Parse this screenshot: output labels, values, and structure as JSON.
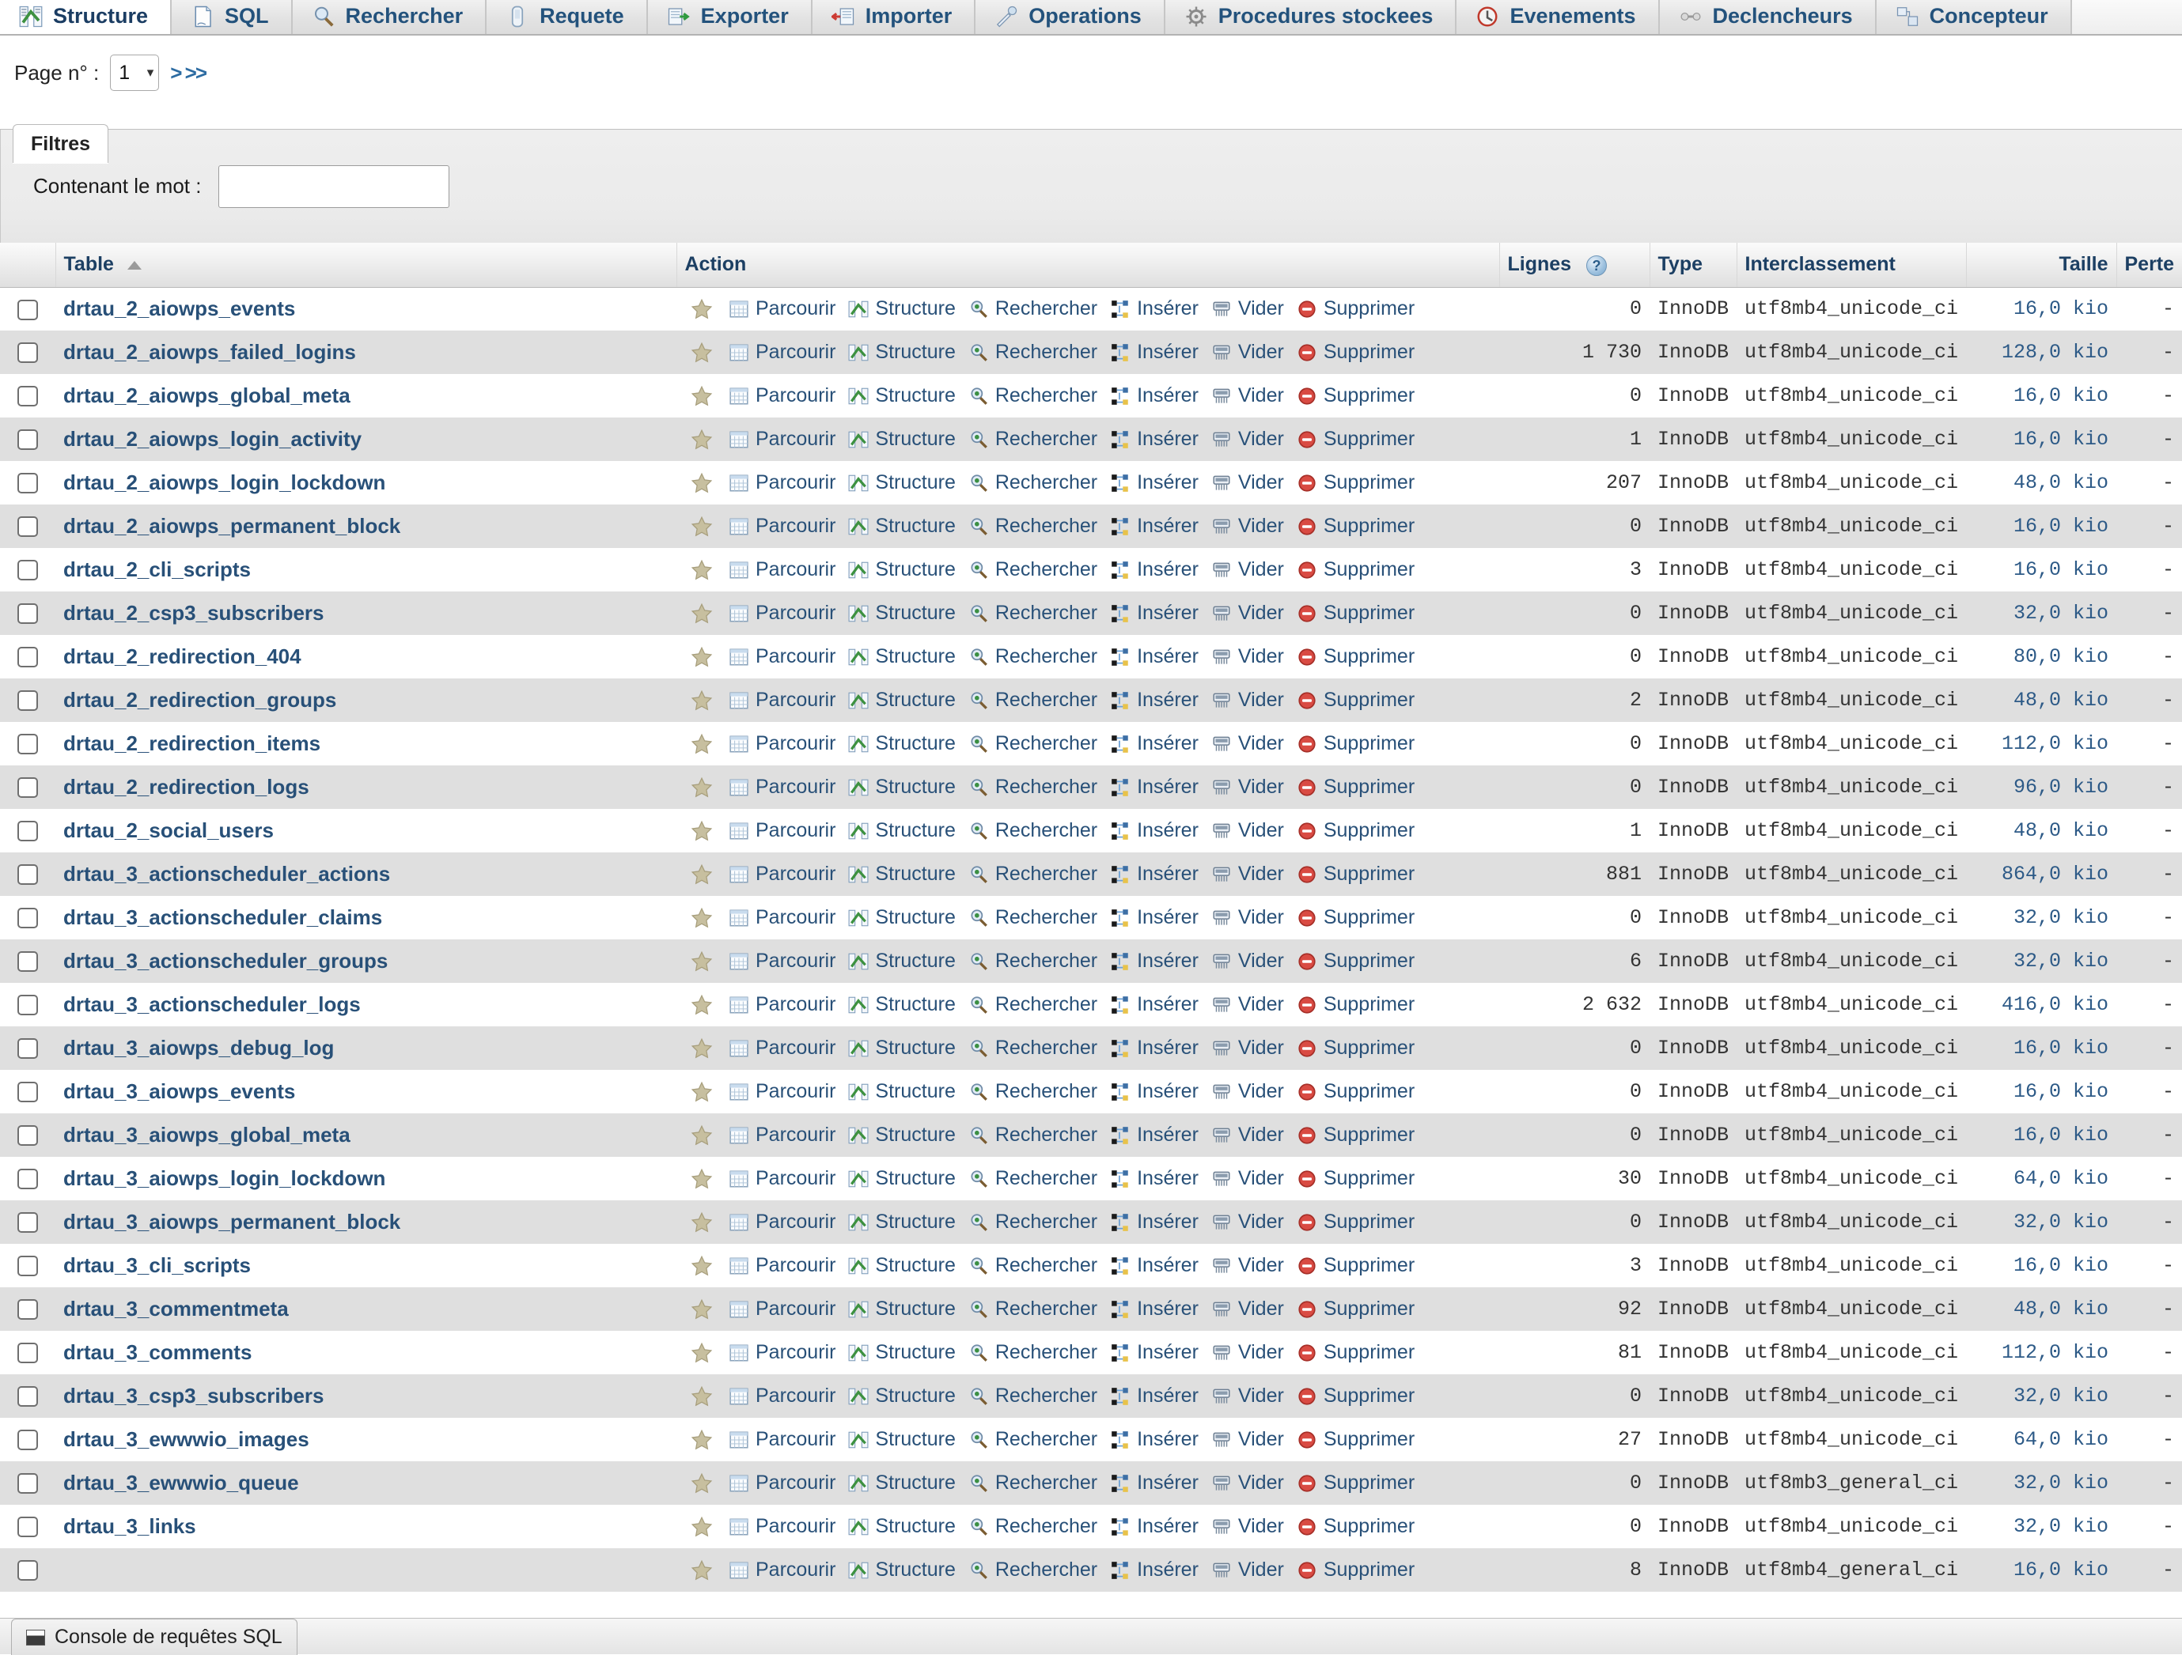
{
  "tabs": [
    {
      "label": "Structure",
      "icon": "structure-icon",
      "active": true
    },
    {
      "label": "SQL",
      "icon": "sql-icon",
      "active": false
    },
    {
      "label": "Rechercher",
      "icon": "search-icon",
      "active": false
    },
    {
      "label": "Requete",
      "icon": "query-icon",
      "active": false
    },
    {
      "label": "Exporter",
      "icon": "export-icon",
      "active": false
    },
    {
      "label": "Importer",
      "icon": "import-icon",
      "active": false
    },
    {
      "label": "Operations",
      "icon": "operations-icon",
      "active": false
    },
    {
      "label": "Procedures stockees",
      "icon": "routines-icon",
      "active": false
    },
    {
      "label": "Evenements",
      "icon": "events-icon",
      "active": false
    },
    {
      "label": "Declencheurs",
      "icon": "triggers-icon",
      "active": false
    },
    {
      "label": "Concepteur",
      "icon": "designer-icon",
      "active": false
    }
  ],
  "pagination": {
    "label": "Page n° :",
    "current_page": "1",
    "next_arrows": "> >>"
  },
  "filters": {
    "legend": "Filtres",
    "word_label": "Contenant le mot :",
    "word_value": "",
    "word_placeholder": ""
  },
  "table_headers": {
    "table": "Table",
    "action": "Action",
    "rows": "Lignes",
    "type": "Type",
    "collation": "Interclassement",
    "size": "Taille",
    "overhead": "Perte"
  },
  "actions": {
    "favorite": "",
    "browse": "Parcourir",
    "structure": "Structure",
    "search": "Rechercher",
    "insert": "Insérer",
    "empty": "Vider",
    "drop": "Supprimer"
  },
  "console": {
    "label": "Console de requêtes SQL"
  },
  "colors": {
    "link": "#285078",
    "header_text": "#1c3f63",
    "row_even": "#dfdfdf",
    "row_odd": "#ffffff",
    "size_text": "#2d5a87"
  },
  "rows": [
    {
      "name": "drtau_2_aiowps_events",
      "rows": "0",
      "type": "InnoDB",
      "collation": "utf8mb4_unicode_ci",
      "size": "16,0 kio",
      "overhead": "-"
    },
    {
      "name": "drtau_2_aiowps_failed_logins",
      "rows": "1 730",
      "type": "InnoDB",
      "collation": "utf8mb4_unicode_ci",
      "size": "128,0 kio",
      "overhead": "-"
    },
    {
      "name": "drtau_2_aiowps_global_meta",
      "rows": "0",
      "type": "InnoDB",
      "collation": "utf8mb4_unicode_ci",
      "size": "16,0 kio",
      "overhead": "-"
    },
    {
      "name": "drtau_2_aiowps_login_activity",
      "rows": "1",
      "type": "InnoDB",
      "collation": "utf8mb4_unicode_ci",
      "size": "16,0 kio",
      "overhead": "-"
    },
    {
      "name": "drtau_2_aiowps_login_lockdown",
      "rows": "207",
      "type": "InnoDB",
      "collation": "utf8mb4_unicode_ci",
      "size": "48,0 kio",
      "overhead": "-"
    },
    {
      "name": "drtau_2_aiowps_permanent_block",
      "rows": "0",
      "type": "InnoDB",
      "collation": "utf8mb4_unicode_ci",
      "size": "16,0 kio",
      "overhead": "-"
    },
    {
      "name": "drtau_2_cli_scripts",
      "rows": "3",
      "type": "InnoDB",
      "collation": "utf8mb4_unicode_ci",
      "size": "16,0 kio",
      "overhead": "-"
    },
    {
      "name": "drtau_2_csp3_subscribers",
      "rows": "0",
      "type": "InnoDB",
      "collation": "utf8mb4_unicode_ci",
      "size": "32,0 kio",
      "overhead": "-"
    },
    {
      "name": "drtau_2_redirection_404",
      "rows": "0",
      "type": "InnoDB",
      "collation": "utf8mb4_unicode_ci",
      "size": "80,0 kio",
      "overhead": "-"
    },
    {
      "name": "drtau_2_redirection_groups",
      "rows": "2",
      "type": "InnoDB",
      "collation": "utf8mb4_unicode_ci",
      "size": "48,0 kio",
      "overhead": "-"
    },
    {
      "name": "drtau_2_redirection_items",
      "rows": "0",
      "type": "InnoDB",
      "collation": "utf8mb4_unicode_ci",
      "size": "112,0 kio",
      "overhead": "-"
    },
    {
      "name": "drtau_2_redirection_logs",
      "rows": "0",
      "type": "InnoDB",
      "collation": "utf8mb4_unicode_ci",
      "size": "96,0 kio",
      "overhead": "-"
    },
    {
      "name": "drtau_2_social_users",
      "rows": "1",
      "type": "InnoDB",
      "collation": "utf8mb4_unicode_ci",
      "size": "48,0 kio",
      "overhead": "-"
    },
    {
      "name": "drtau_3_actionscheduler_actions",
      "rows": "881",
      "type": "InnoDB",
      "collation": "utf8mb4_unicode_ci",
      "size": "864,0 kio",
      "overhead": "-"
    },
    {
      "name": "drtau_3_actionscheduler_claims",
      "rows": "0",
      "type": "InnoDB",
      "collation": "utf8mb4_unicode_ci",
      "size": "32,0 kio",
      "overhead": "-"
    },
    {
      "name": "drtau_3_actionscheduler_groups",
      "rows": "6",
      "type": "InnoDB",
      "collation": "utf8mb4_unicode_ci",
      "size": "32,0 kio",
      "overhead": "-"
    },
    {
      "name": "drtau_3_actionscheduler_logs",
      "rows": "2 632",
      "type": "InnoDB",
      "collation": "utf8mb4_unicode_ci",
      "size": "416,0 kio",
      "overhead": "-"
    },
    {
      "name": "drtau_3_aiowps_debug_log",
      "rows": "0",
      "type": "InnoDB",
      "collation": "utf8mb4_unicode_ci",
      "size": "16,0 kio",
      "overhead": "-"
    },
    {
      "name": "drtau_3_aiowps_events",
      "rows": "0",
      "type": "InnoDB",
      "collation": "utf8mb4_unicode_ci",
      "size": "16,0 kio",
      "overhead": "-"
    },
    {
      "name": "drtau_3_aiowps_global_meta",
      "rows": "0",
      "type": "InnoDB",
      "collation": "utf8mb4_unicode_ci",
      "size": "16,0 kio",
      "overhead": "-"
    },
    {
      "name": "drtau_3_aiowps_login_lockdown",
      "rows": "30",
      "type": "InnoDB",
      "collation": "utf8mb4_unicode_ci",
      "size": "64,0 kio",
      "overhead": "-"
    },
    {
      "name": "drtau_3_aiowps_permanent_block",
      "rows": "0",
      "type": "InnoDB",
      "collation": "utf8mb4_unicode_ci",
      "size": "32,0 kio",
      "overhead": "-"
    },
    {
      "name": "drtau_3_cli_scripts",
      "rows": "3",
      "type": "InnoDB",
      "collation": "utf8mb4_unicode_ci",
      "size": "16,0 kio",
      "overhead": "-"
    },
    {
      "name": "drtau_3_commentmeta",
      "rows": "92",
      "type": "InnoDB",
      "collation": "utf8mb4_unicode_ci",
      "size": "48,0 kio",
      "overhead": "-"
    },
    {
      "name": "drtau_3_comments",
      "rows": "81",
      "type": "InnoDB",
      "collation": "utf8mb4_unicode_ci",
      "size": "112,0 kio",
      "overhead": "-"
    },
    {
      "name": "drtau_3_csp3_subscribers",
      "rows": "0",
      "type": "InnoDB",
      "collation": "utf8mb4_unicode_ci",
      "size": "32,0 kio",
      "overhead": "-"
    },
    {
      "name": "drtau_3_ewwwio_images",
      "rows": "27",
      "type": "InnoDB",
      "collation": "utf8mb4_unicode_ci",
      "size": "64,0 kio",
      "overhead": "-"
    },
    {
      "name": "drtau_3_ewwwio_queue",
      "rows": "0",
      "type": "InnoDB",
      "collation": "utf8mb3_general_ci",
      "size": "32,0 kio",
      "overhead": "-"
    },
    {
      "name": "drtau_3_links",
      "rows": "0",
      "type": "InnoDB",
      "collation": "utf8mb4_unicode_ci",
      "size": "32,0 kio",
      "overhead": "-"
    },
    {
      "name": "",
      "rows": "8",
      "type": "InnoDB",
      "collation": "utf8mb4_general_ci",
      "size": "16,0 kio",
      "overhead": "-"
    }
  ]
}
